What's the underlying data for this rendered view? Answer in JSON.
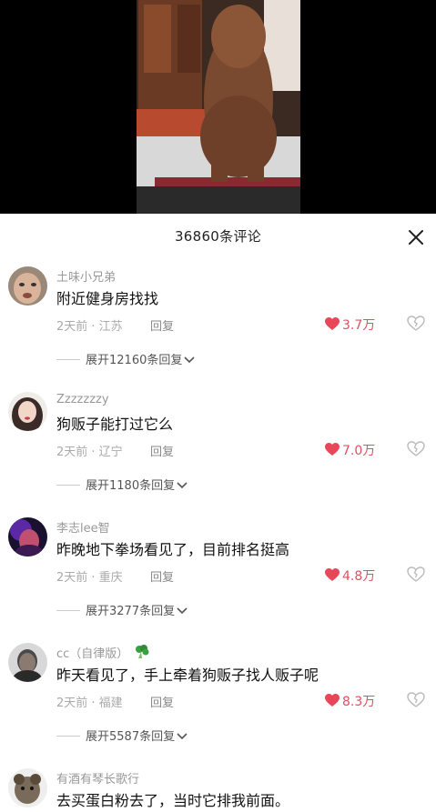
{
  "header": {
    "title": "36860条评论"
  },
  "comments": [
    {
      "user": "土味小兄弟",
      "text": "附近健身房找找",
      "meta": "2天前 · 江苏",
      "reply": "回复",
      "likes": "3.7万",
      "expand": "展开12160条回复"
    },
    {
      "user": "Zzzzzzzy",
      "text": "狗贩子能打过它么",
      "meta": "2天前 · 辽宁",
      "reply": "回复",
      "likes": "7.0万",
      "expand": "展开1180条回复"
    },
    {
      "user": "李志lee智",
      "text": "昨晚地下拳场看见了，目前排名挺高",
      "meta": "2天前 · 重庆",
      "reply": "回复",
      "likes": "4.8万",
      "expand": "展开3277条回复"
    },
    {
      "user": "cc（自律版）",
      "text": "昨天看见了，手上牵着狗贩子找人贩子呢",
      "meta": "2天前 · 福建",
      "reply": "回复",
      "likes": "8.3万",
      "expand": "展开5587条回复"
    },
    {
      "user": "有酒有琴长歌行",
      "text": "去买蛋白粉去了，当时它排我前面。"
    }
  ],
  "colors": {
    "like": "#e8475a",
    "muted": "#999999",
    "text": "#111111"
  },
  "icons": {
    "close": "close-icon",
    "like": "heart-icon",
    "dislike": "broken-heart-icon",
    "expand": "chevron-down-icon",
    "badge": "broccoli-icon"
  }
}
